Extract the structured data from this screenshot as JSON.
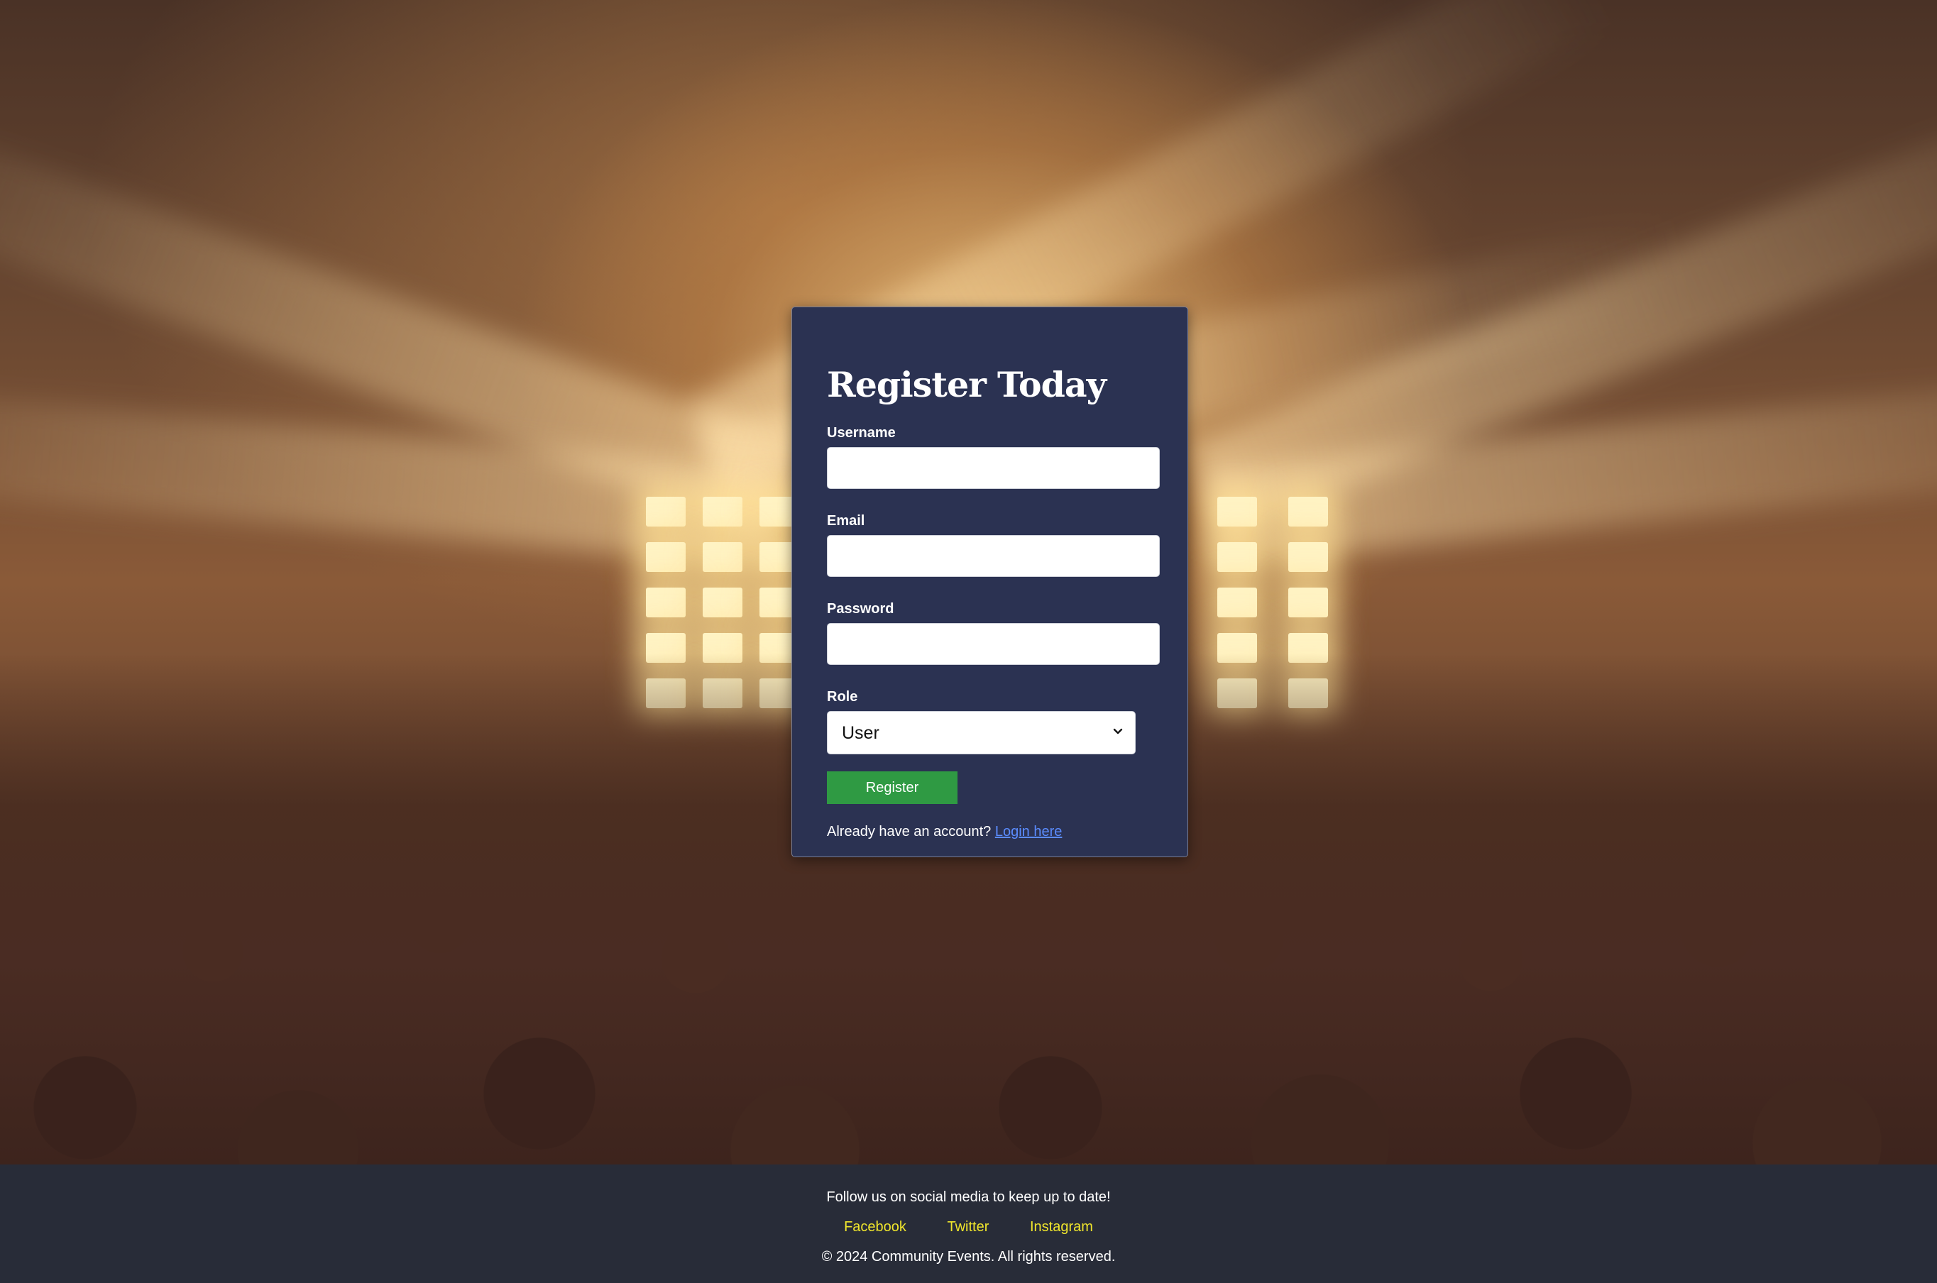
{
  "form": {
    "title": "Register Today",
    "username_label": "Username",
    "email_label": "Email",
    "password_label": "Password",
    "role_label": "Role",
    "role_selected": "User",
    "register_label": "Register",
    "login_prompt": "Already have an account?",
    "login_link": "Login here"
  },
  "footer": {
    "tagline": "Follow us on social media to keep up to date!",
    "links": [
      {
        "label": "Facebook"
      },
      {
        "label": "Twitter"
      },
      {
        "label": "Instagram"
      }
    ],
    "copyright": "© 2024 Community Events. All rights reserved."
  },
  "colors": {
    "card_background": "#2b3252",
    "register_button": "#2f9a43",
    "login_link": "#5b8cff",
    "footer_background": "#282c38",
    "footer_link": "#f0e62c"
  },
  "icons": {
    "select_arrow": "chevron-down-icon"
  }
}
